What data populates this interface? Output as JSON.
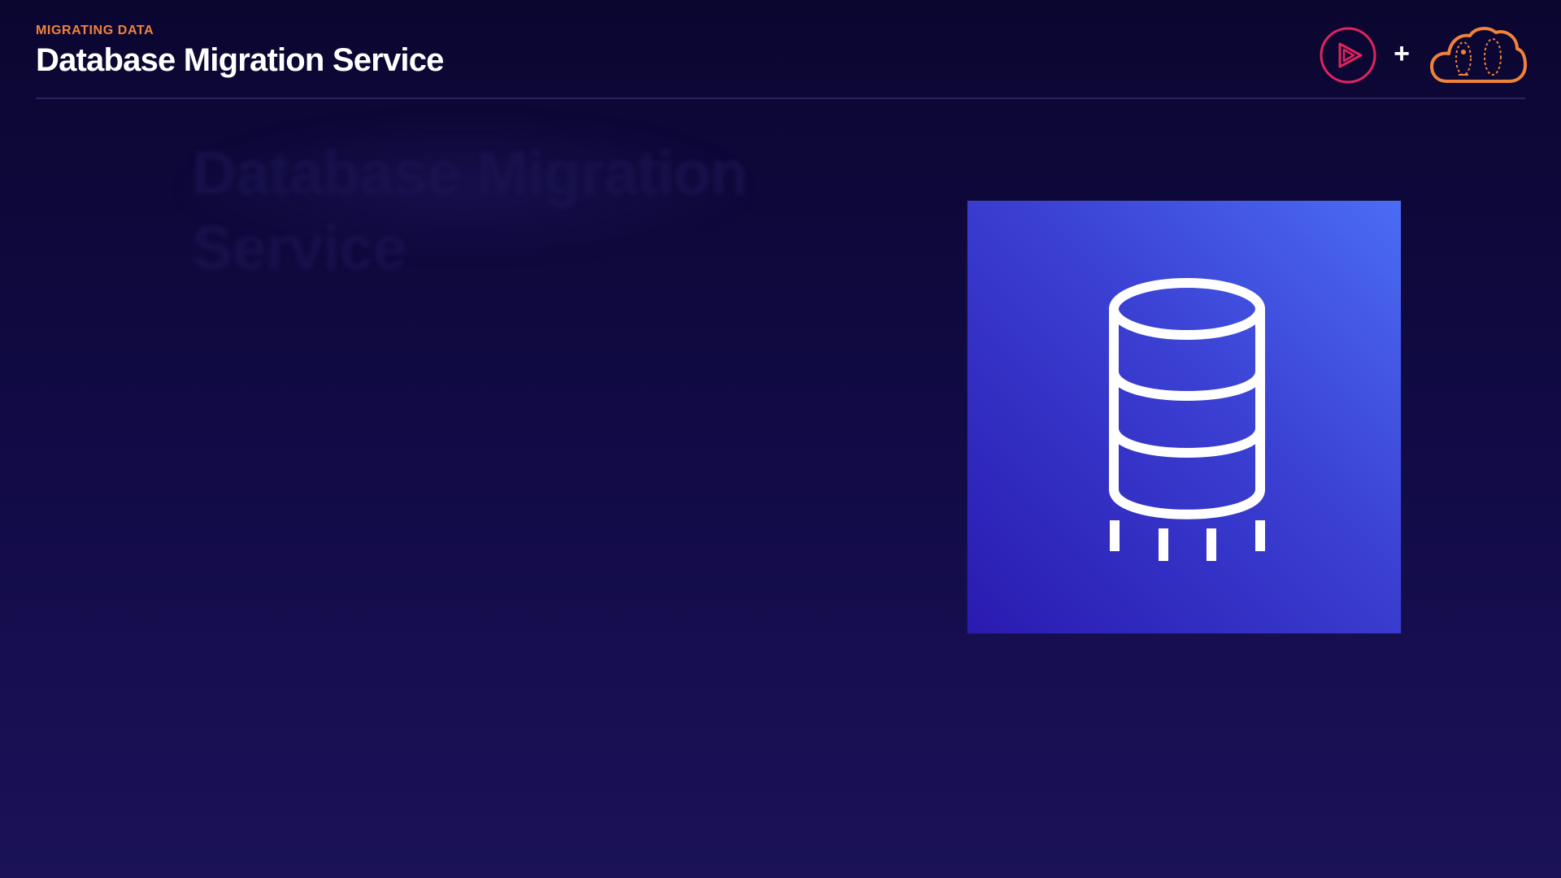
{
  "slide": {
    "eyebrow": "MIGRATING DATA",
    "title": "Database Migration Service",
    "ghost_title": "Database Migration Service"
  },
  "branding": {
    "plus": "+",
    "play_icon": "pluralsight-play-icon",
    "cloud_icon": "cloud-guru-cloud-icon",
    "play_color": "#e0245e",
    "cloud_color": "#f0833a"
  },
  "service": {
    "icon": "database-migration-service-icon",
    "gradient": [
      "#2a1ab0",
      "#4b6cf4"
    ]
  }
}
